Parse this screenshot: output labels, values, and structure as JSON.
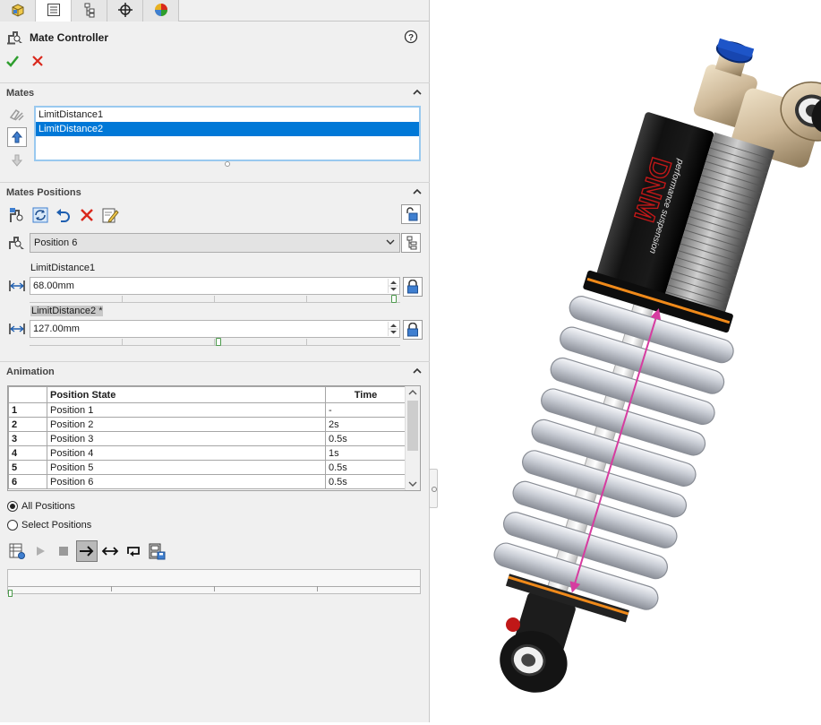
{
  "tabs": [
    {
      "icon": "feature-manager-icon"
    },
    {
      "icon": "property-manager-icon"
    },
    {
      "icon": "configuration-manager-icon"
    },
    {
      "icon": "dimxpert-icon"
    },
    {
      "icon": "display-manager-icon"
    }
  ],
  "header": {
    "title": "Mate Controller"
  },
  "sections": {
    "mates": "Mates",
    "positions": "Mates Positions",
    "animation": "Animation"
  },
  "mates_list": [
    {
      "label": "LimitDistance1",
      "selected": false
    },
    {
      "label": "LimitDistance2",
      "selected": true
    }
  ],
  "position_select": {
    "value": "Position 6"
  },
  "limit1": {
    "label": "LimitDistance1",
    "value": "68.00mm",
    "slider_fraction": 0.99
  },
  "limit2": {
    "label": "LimitDistance2 *",
    "value": "127.00mm",
    "slider_fraction": 0.51
  },
  "animation_table": {
    "columns": [
      "",
      "Position State",
      "Time"
    ],
    "rows": [
      [
        "1",
        "Position 1",
        "-"
      ],
      [
        "2",
        "Position 2",
        "2s"
      ],
      [
        "3",
        "Position 3",
        "0.5s"
      ],
      [
        "4",
        "Position 4",
        "1s"
      ],
      [
        "5",
        "Position 5",
        "0.5s"
      ],
      [
        "6",
        "Position 6",
        "0.5s"
      ]
    ]
  },
  "radio": {
    "all": "All Positions",
    "select": "Select Positions",
    "selected": "all"
  },
  "colors": {
    "accent": "#0078d7",
    "ok": "#2e9e2e",
    "cancel": "#d9281c",
    "spring": "#c8ccd4",
    "bronze": "#cdb898",
    "orange": "#f08a1a",
    "magenta": "#d63ca0"
  }
}
